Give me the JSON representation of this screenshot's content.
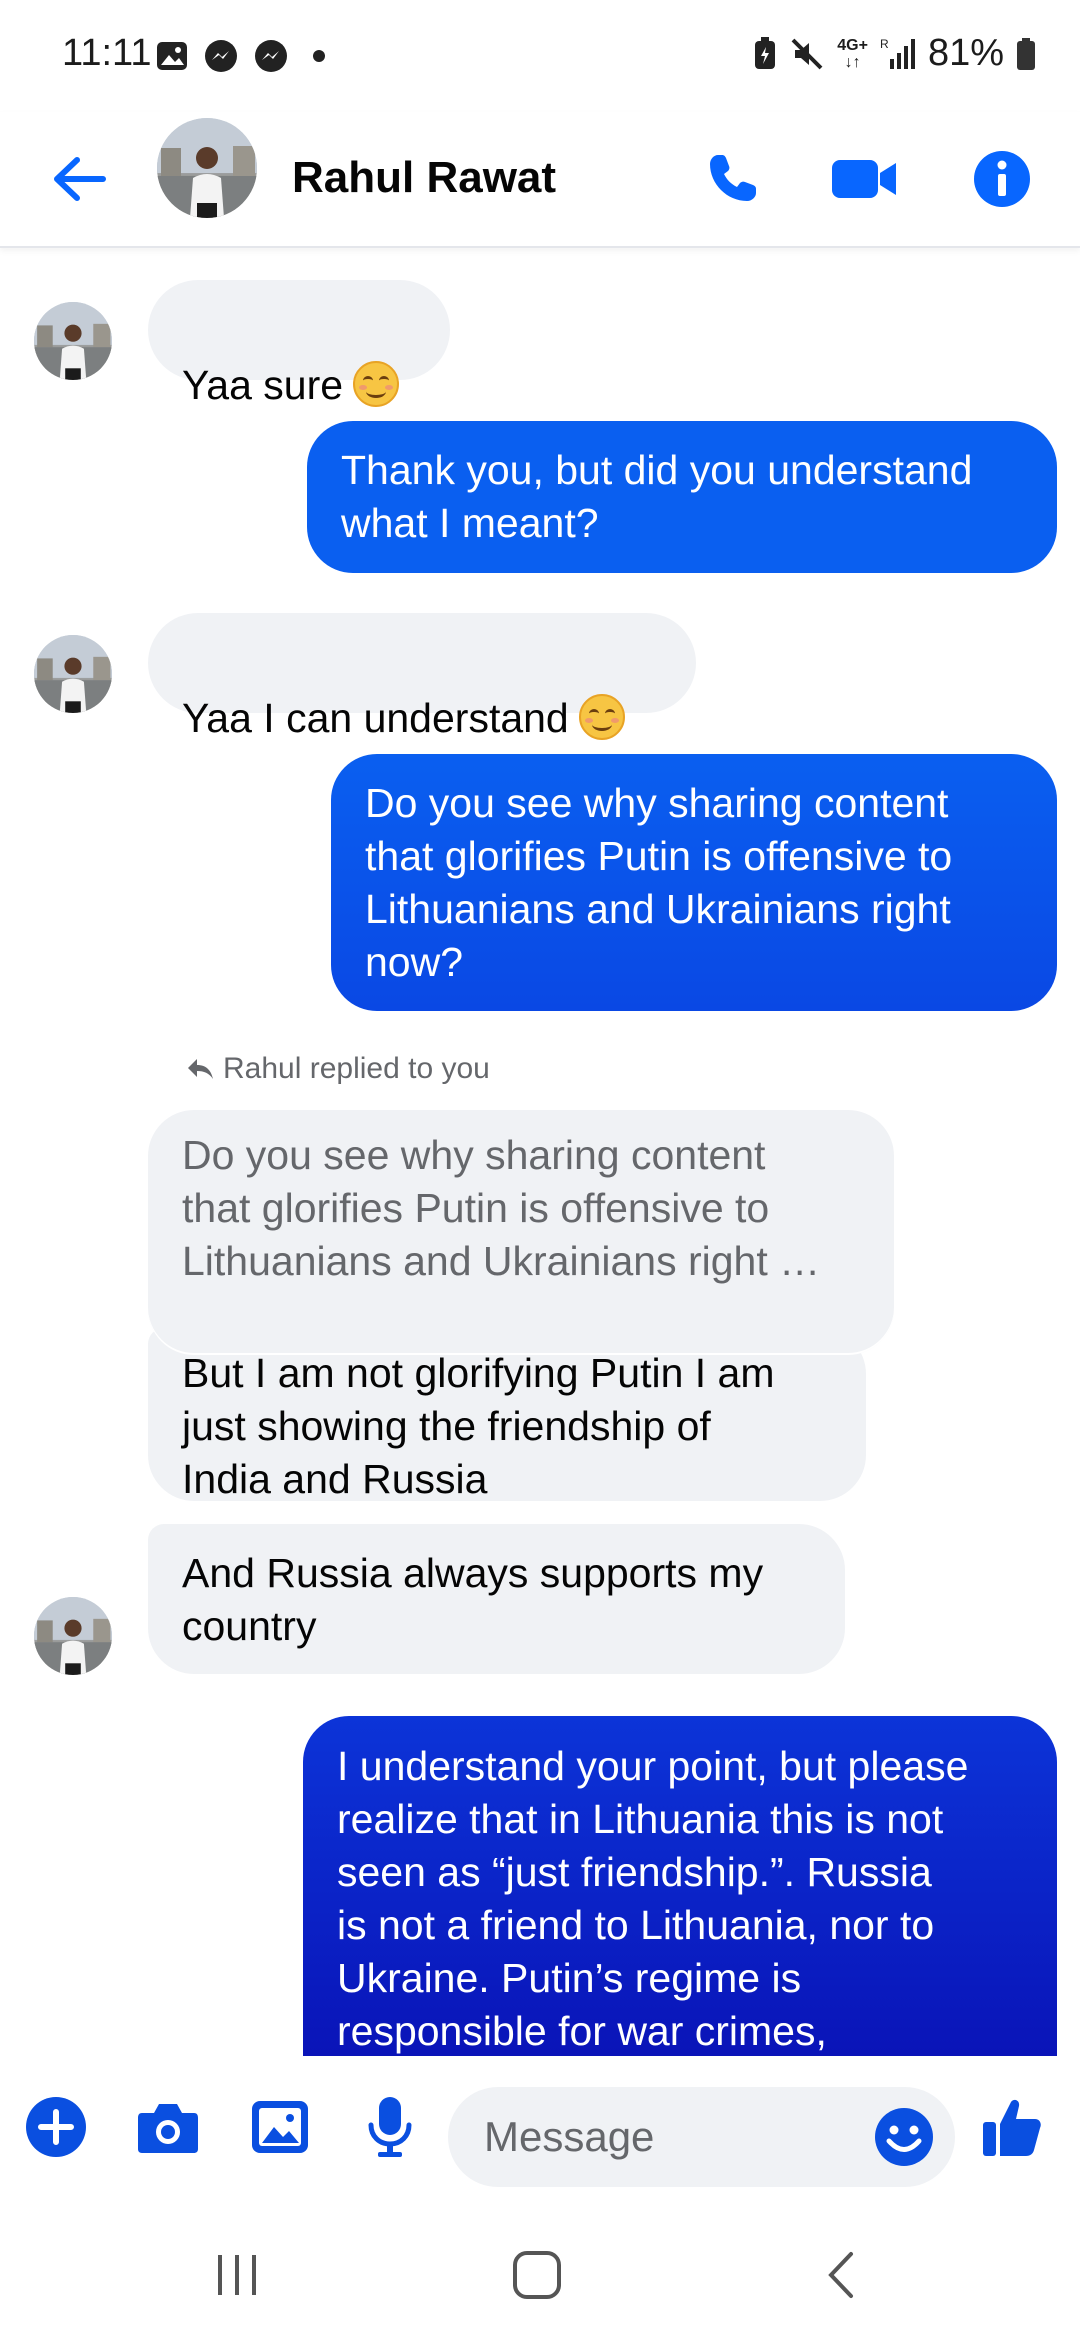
{
  "status_bar": {
    "time": "11:11",
    "network": "4G+",
    "battery": "81%"
  },
  "header": {
    "contact_name": "Rahul Rawat"
  },
  "messages": [
    {
      "direction": "incoming",
      "text": "Yaa sure",
      "emoji": "smiling-face-icon"
    },
    {
      "direction": "outgoing",
      "text": "Thank you, but did you understand\nwhat I meant?"
    },
    {
      "direction": "incoming",
      "text": "Yaa I can understand",
      "emoji": "smiling-face-icon"
    },
    {
      "direction": "outgoing",
      "text": "Do you see why sharing content\nthat glorifies Putin is offensive to\nLithuanians and Ukrainians right\nnow?"
    },
    {
      "direction": "incoming",
      "reply_label": "Rahul replied to you",
      "quoted_text": "Do you see why sharing content\nthat glorifies Putin is offensive to\nLithuanians and Ukrainians right …",
      "text": "But I am not glorifying Putin I am\njust showing the friendship of\nIndia and Russia"
    },
    {
      "direction": "incoming",
      "text": "And Russia always supports my\ncountry"
    },
    {
      "direction": "outgoing",
      "text": "I understand your point, but please\nrealize that in Lithuania this is not\nseen as “just friendship.”. Russia\nis not a friend to Lithuania, nor to\nUkraine. Putin’s regime is\nresponsible for war crimes,"
    }
  ],
  "composer": {
    "placeholder": "Message"
  },
  "colors": {
    "accent": "#0866ff",
    "outgoing_top": "#0a5ff0",
    "outgoing_bottom": "#0a1fcf",
    "incoming_bg": "#f0f2f5"
  }
}
